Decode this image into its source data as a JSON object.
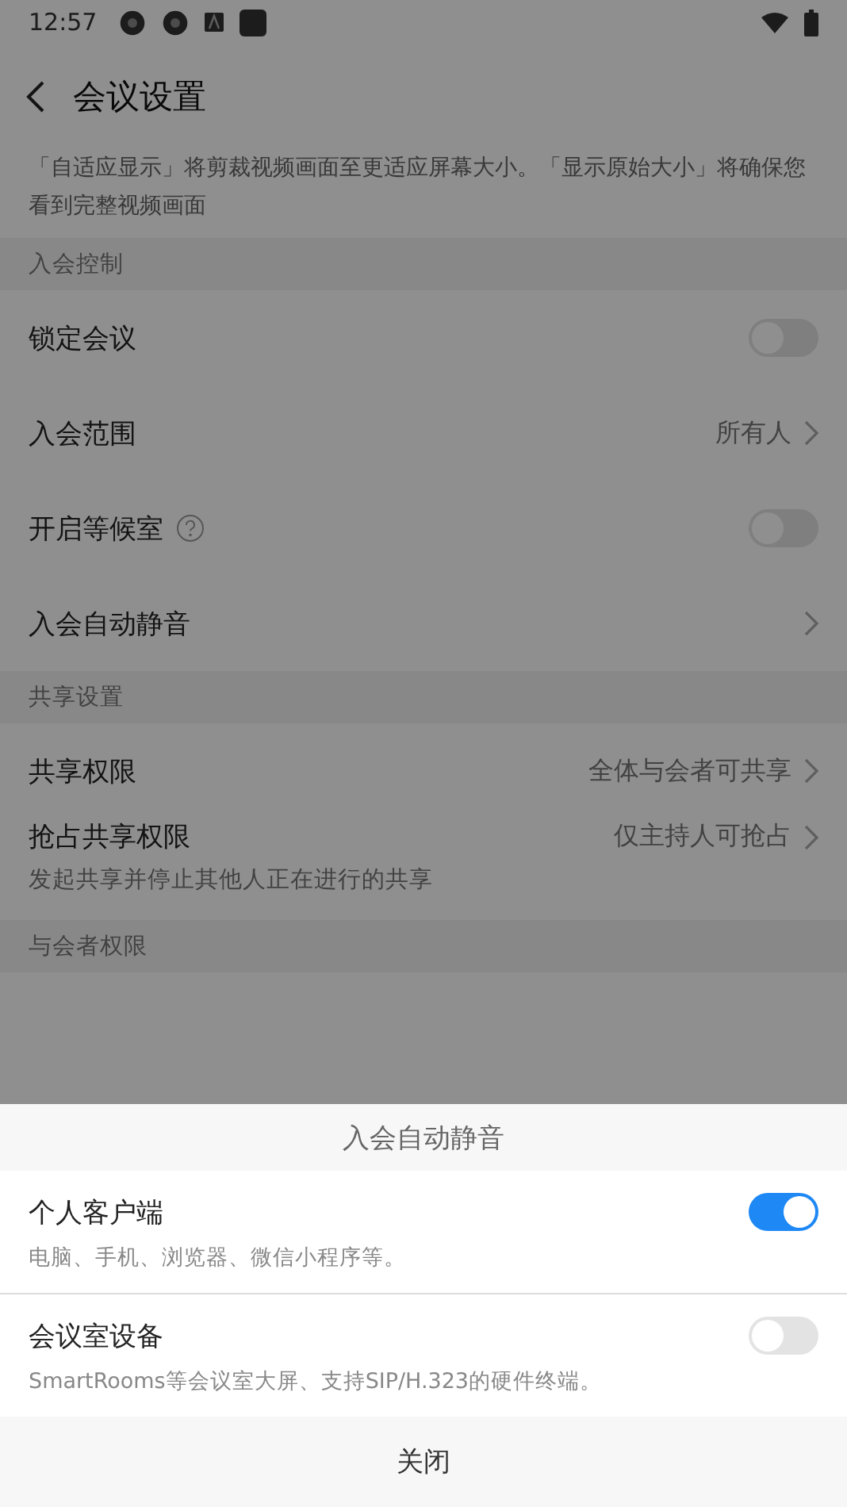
{
  "status_bar": {
    "time": "12:57"
  },
  "header": {
    "title": "会议设置"
  },
  "description": "「自适应显示」将剪裁视频画面至更适应屏幕大小。「显示原始大小」将确保您看到完整视频画面",
  "sections": [
    {
      "title": "入会控制",
      "rows": [
        {
          "kind": "toggle",
          "label": "锁定会议",
          "on": false
        },
        {
          "kind": "link",
          "label": "入会范围",
          "value": "所有人"
        },
        {
          "kind": "toggle",
          "label": "开启等候室",
          "on": false,
          "help": true
        },
        {
          "kind": "link",
          "label": "入会自动静音"
        }
      ]
    },
    {
      "title": "共享设置",
      "rows": [
        {
          "kind": "link",
          "label": "共享权限",
          "value": "全体与会者可共享"
        },
        {
          "kind": "link",
          "label": "抢占共享权限",
          "value": "仅主持人可抢占",
          "note": "发起共享并停止其他人正在进行的共享"
        }
      ]
    },
    {
      "title": "与会者权限"
    }
  ],
  "sheet": {
    "title": "入会自动静音",
    "options": [
      {
        "label": "个人客户端",
        "description": "电脑、手机、浏览器、微信小程序等。",
        "on": true
      },
      {
        "label": "会议室设备",
        "description": "SmartRooms等会议室大屏、支持SIP/H.323的硬件终端。",
        "on": false
      }
    ],
    "close": "关闭"
  }
}
